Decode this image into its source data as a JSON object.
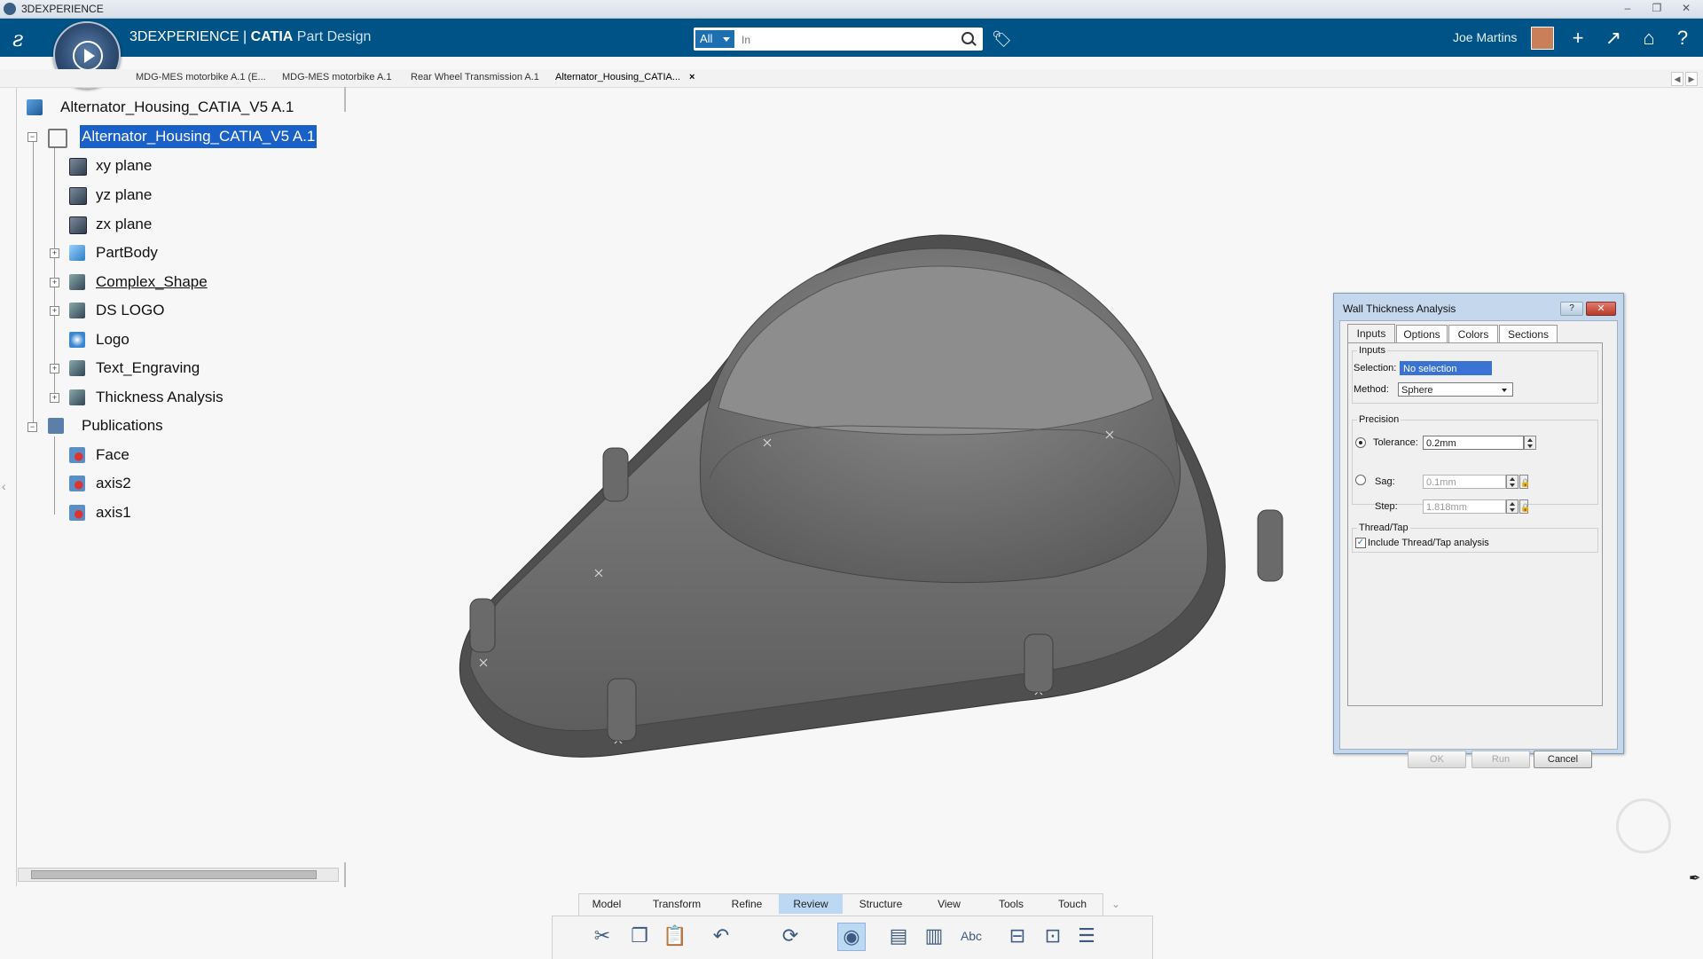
{
  "window": {
    "title": "3DEXPERIENCE",
    "controls": [
      "–",
      "❐",
      "✕"
    ]
  },
  "header": {
    "brand_prefix": "3DEXPERIENCE",
    "brand_sep": " | ",
    "brand_app": "CATIA",
    "brand_role": " Part Design",
    "search_scope": "All",
    "search_placeholder": "In",
    "user_name": "Joe Martins",
    "accent": "#005386"
  },
  "tabs": [
    {
      "label": "MDG-MES motorbike A.1 (E..."
    },
    {
      "label": "MDG-MES motorbike A.1"
    },
    {
      "label": "Rear Wheel Transmission A.1"
    },
    {
      "label": "Alternator_Housing_CATIA...",
      "close": "×"
    }
  ],
  "tree": {
    "root": "Alternator_Housing_CATIA_V5 A.1",
    "part": "Alternator_Housing_CATIA_V5 A.1",
    "items": [
      {
        "label": "xy plane",
        "icon": "plane-icon"
      },
      {
        "label": "yz plane",
        "icon": "plane-icon"
      },
      {
        "label": "zx plane",
        "icon": "plane-icon"
      },
      {
        "label": "PartBody",
        "icon": "body-icon"
      },
      {
        "label": "Complex_Shape",
        "icon": "shape-icon"
      },
      {
        "label": "DS LOGO",
        "icon": "shape-icon"
      },
      {
        "label": "Logo",
        "icon": "logo-icon"
      },
      {
        "label": "Text_Engraving",
        "icon": "shape-icon"
      },
      {
        "label": "Thickness Analysis",
        "icon": "analysis-icon"
      }
    ],
    "publications": "Publications",
    "pub_items": [
      {
        "label": "Face"
      },
      {
        "label": "axis2"
      },
      {
        "label": "axis1"
      }
    ]
  },
  "dialog": {
    "title": "Wall Thickness Analysis",
    "help": "?",
    "close": "✕",
    "tabs": [
      "Inputs",
      "Options",
      "Colors",
      "Sections"
    ],
    "inputs_group": "Inputs",
    "selection_label": "Selection:",
    "selection_value": "No selection",
    "method_label": "Method:",
    "method_value": "Sphere",
    "precision_group": "Precision",
    "tolerance_label": "Tolerance:",
    "tolerance_value": "0.2mm",
    "sag_label": "Sag:",
    "sag_value": "0.1mm",
    "step_label": "Step:",
    "step_value": "1.818mm",
    "thread_group": "Thread/Tap",
    "thread_check": "Include Thread/Tap analysis",
    "ok": "OK",
    "run": "Run",
    "cancel": "Cancel"
  },
  "action_bar": {
    "tabs": [
      "Model",
      "Transform",
      "Refine",
      "Review",
      "Structure",
      "View",
      "Tools",
      "Touch"
    ],
    "active": "Review"
  }
}
